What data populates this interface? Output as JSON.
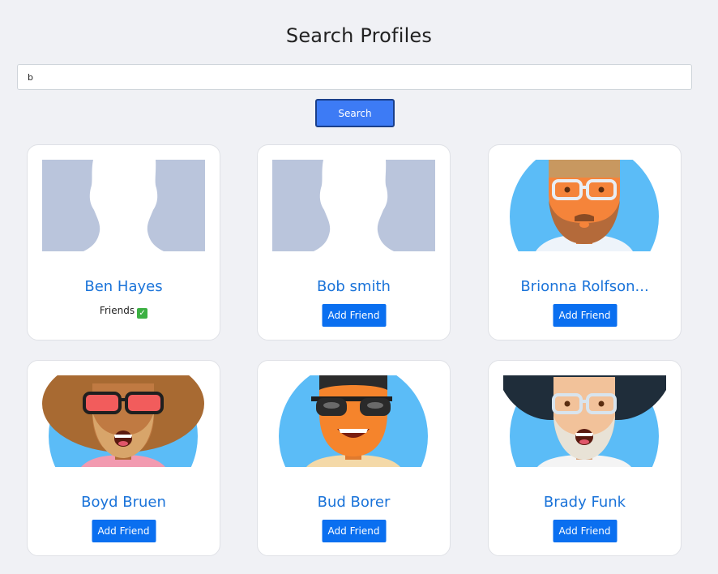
{
  "page": {
    "title": "Search Profiles"
  },
  "search": {
    "value": "b",
    "button_label": "Search"
  },
  "colors": {
    "accent": "#0a6ff0",
    "name_link": "#1a73d9",
    "background": "#f0f1f5",
    "avatar_sky": "#5bbcf7"
  },
  "profiles": [
    {
      "name": "Ben Hayes",
      "avatar": "default-silhouette",
      "status": "Friends",
      "status_icon": "check-icon"
    },
    {
      "name": "Bob smith",
      "avatar": "default-silhouette",
      "action": "Add Friend"
    },
    {
      "name": "Brionna Rolfson...",
      "avatar": "cartoon-bearded-glasses",
      "action": "Add Friend"
    },
    {
      "name": "Boyd Bruen",
      "avatar": "cartoon-curly-hair-red-glasses",
      "action": "Add Friend"
    },
    {
      "name": "Bud Borer",
      "avatar": "cartoon-sunglasses",
      "action": "Add Friend"
    },
    {
      "name": "Brady Funk",
      "avatar": "cartoon-dark-hat-glasses",
      "action": "Add Friend"
    }
  ]
}
